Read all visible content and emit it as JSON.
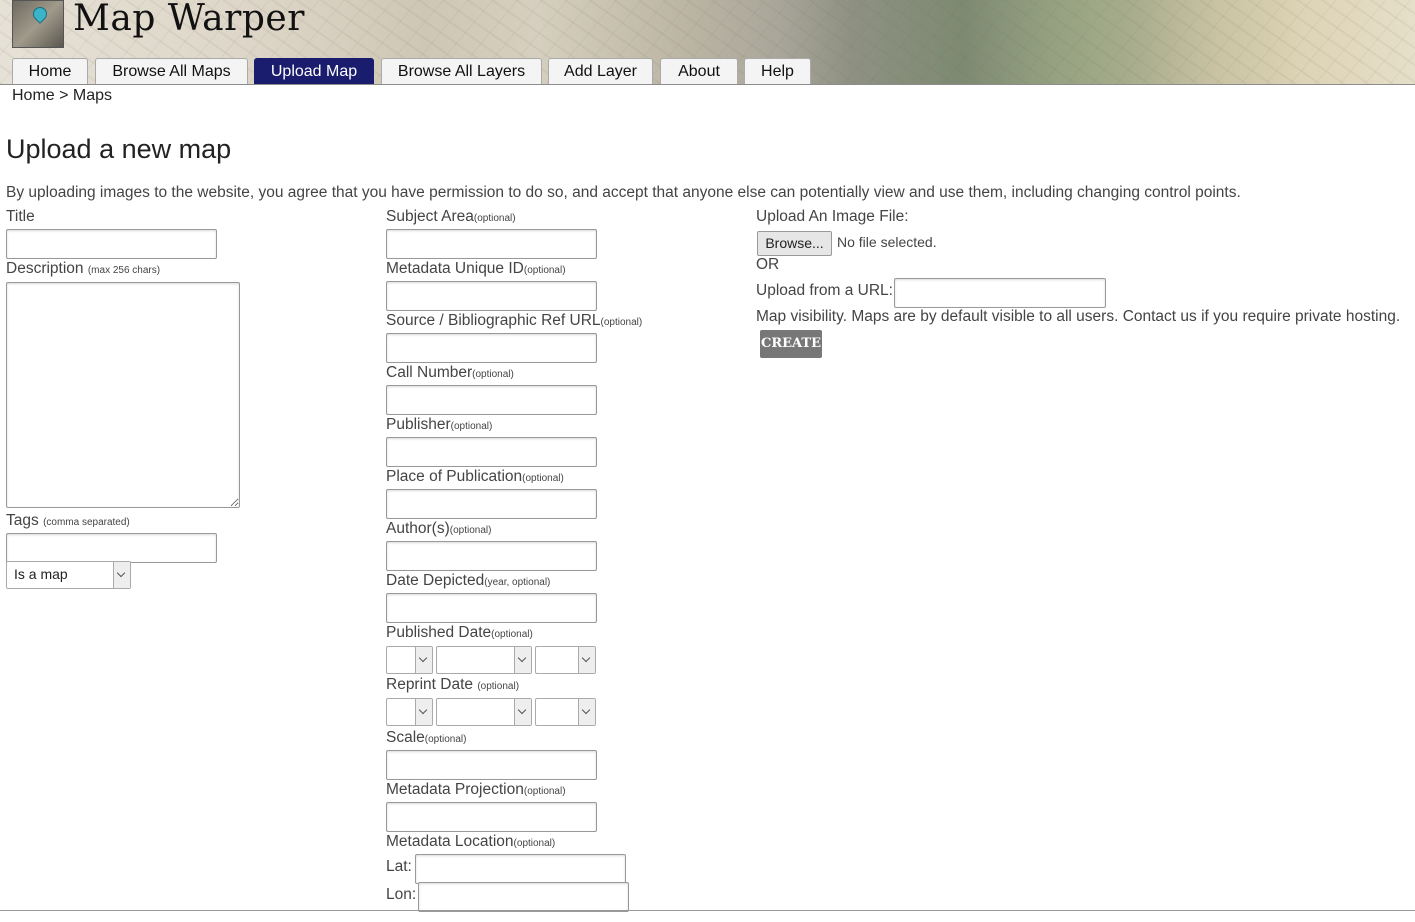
{
  "app": {
    "title": "Map Warper"
  },
  "nav": {
    "tabs": [
      {
        "label": "Home"
      },
      {
        "label": "Browse All Maps"
      },
      {
        "label": "Upload Map"
      },
      {
        "label": "Browse All Layers"
      },
      {
        "label": "Add Layer"
      },
      {
        "label": "About"
      },
      {
        "label": "Help"
      }
    ],
    "active": "Upload Map"
  },
  "breadcrumb": {
    "text": "Home > Maps"
  },
  "page": {
    "title": "Upload a new map",
    "agreement": "By uploading images to the website, you agree that you have permission to do so, and accept that anyone else can potentially view and use them, including changing control points."
  },
  "left": {
    "title_label": "Title",
    "description_label": "Description",
    "description_hint": "(max 256 chars)",
    "tags_label": "Tags",
    "tags_hint": "(comma separated)",
    "map_type_value": "Is a map"
  },
  "middle": {
    "subject_area": "Subject Area",
    "metadata_unique_id": "Metadata Unique ID",
    "source_ref_url": "Source / Bibliographic Ref URL",
    "call_number": "Call Number",
    "publisher": "Publisher",
    "place_of_publication": "Place of Publication",
    "authors": "Author(s)",
    "date_depicted": "Date Depicted",
    "date_depicted_hint": "(year, optional)",
    "published_date": "Published Date",
    "reprint_date": "Reprint Date",
    "reprint_date_hint": "(optional)",
    "scale": "Scale",
    "metadata_projection": "Metadata Projection",
    "metadata_location": "Metadata Location",
    "lat_label": "Lat:",
    "lon_label": "Lon:",
    "optional_hint": "(optional)"
  },
  "right": {
    "upload_file_label": "Upload An Image File:",
    "browse_label": "Browse...",
    "no_file_text": "No file selected.",
    "or_text": "OR",
    "upload_url_label": "Upload from a URL:",
    "visibility_text": "Map visibility. Maps are by default visible to all users. Contact us if you require private hosting.",
    "create_label": "CREATE"
  },
  "colors": {
    "active_tab": "#1a1d6e",
    "create_button": "#777777"
  }
}
